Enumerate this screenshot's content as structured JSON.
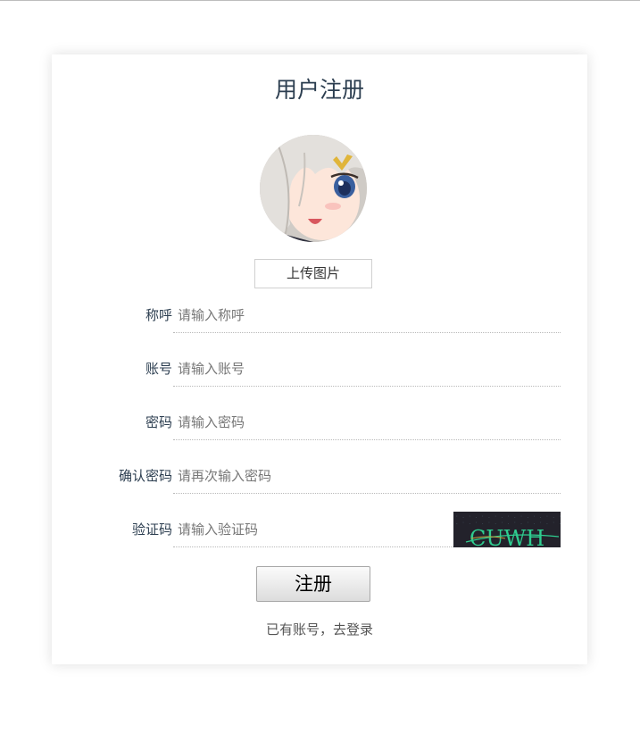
{
  "page": {
    "title": "用户注册"
  },
  "avatar": {
    "icon": "anime-avatar-image",
    "upload_label": "上传图片"
  },
  "form": {
    "fields": [
      {
        "label": "称呼",
        "placeholder": "请输入称呼",
        "value": ""
      },
      {
        "label": "账号",
        "placeholder": "请输入账号",
        "value": ""
      },
      {
        "label": "密码",
        "placeholder": "请输入密码",
        "value": ""
      },
      {
        "label": "确认密码",
        "placeholder": "请再次输入密码",
        "value": ""
      },
      {
        "label": "验证码",
        "placeholder": "请输入验证码",
        "value": ""
      }
    ],
    "captcha_text": "CUWH",
    "submit_label": "注册",
    "login_link": "已有账号，去登录"
  },
  "colors": {
    "title": "#2c3e50",
    "captcha_bg": "#23222b",
    "captcha_text": "#2ecc8f"
  }
}
